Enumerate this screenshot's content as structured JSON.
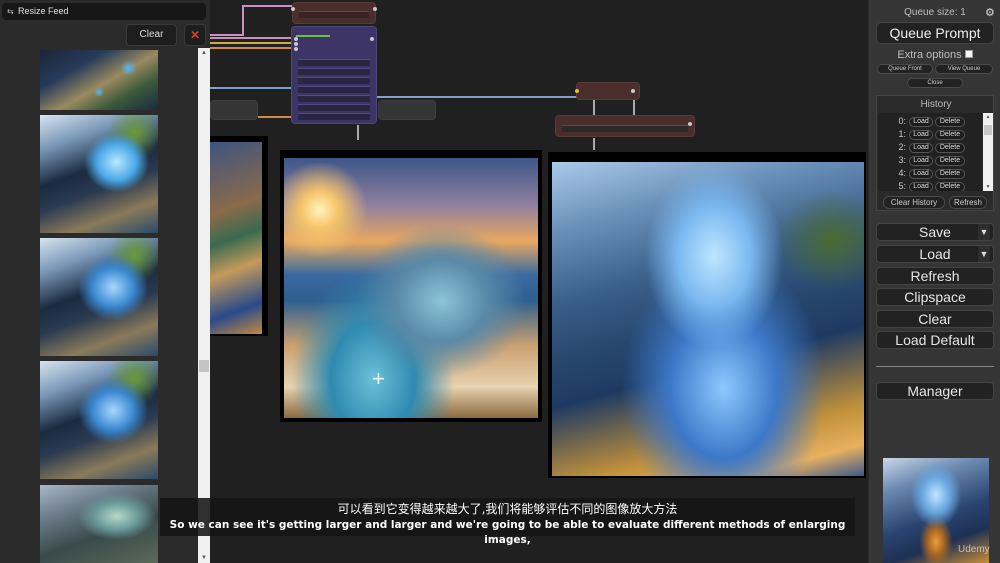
{
  "feed": {
    "title": "Resize Feed",
    "title_icon": "feed-icon",
    "clear_label": "Clear",
    "close_label": "✕",
    "scroll_up": "▲",
    "scroll_down": "▼",
    "thumbnails": 5
  },
  "menu": {
    "queue_size": "Queue size: 1",
    "settings_icon": "⚙",
    "queue_prompt": "Queue Prompt",
    "extra_options": "Extra options",
    "extra_options_checked": false,
    "queue_front": "Queue Front",
    "view_queue": "View Queue",
    "close": "Close",
    "history": {
      "title": "History",
      "items": [
        {
          "index": "0:",
          "load": "Load",
          "delete": "Delete"
        },
        {
          "index": "1:",
          "load": "Load",
          "delete": "Delete"
        },
        {
          "index": "2:",
          "load": "Load",
          "delete": "Delete"
        },
        {
          "index": "3:",
          "load": "Load",
          "delete": "Delete"
        },
        {
          "index": "4:",
          "load": "Load",
          "delete": "Delete"
        },
        {
          "index": "5:",
          "load": "Load",
          "delete": "Delete"
        }
      ],
      "clear_history": "Clear History",
      "refresh": "Refresh"
    },
    "save": "Save",
    "load": "Load",
    "refresh": "Refresh",
    "clipspace": "Clipspace",
    "clear": "Clear",
    "load_default": "Load Default",
    "manager": "Manager",
    "dropdown_caret": "▼"
  },
  "subtitles": {
    "chinese": "可以看到它变得越来越大了,我们将能够评估不同的图像放大方法",
    "english": "So we can see it's getting larger and larger and we're going to be able to evaluate different methods of enlarging images,"
  },
  "watermark": "Udemy",
  "cursor": "+",
  "colors": {
    "canvas_bg": "#202020",
    "node_brown": "#4a2e2b",
    "node_purple": "#3c3565",
    "link_blue": "#7fa0c8",
    "link_pink": "#c98fc0",
    "link_yellow": "#c8b040",
    "link_orange": "#d08a4a",
    "close_red": "#e23b2b"
  }
}
